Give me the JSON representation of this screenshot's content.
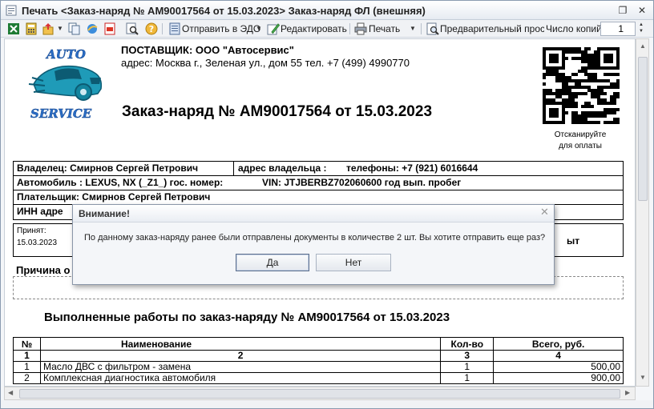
{
  "window": {
    "title": "Печать <Заказ-наряд № АМ90017564 от 15.03.2023> Заказ-наряд ФЛ (внешняя)"
  },
  "toolbar": {
    "send_edo": "Отправить в ЭДО",
    "edit": "Редактировать",
    "print": "Печать",
    "preview": "Предварительный просмотр",
    "copies_label": "Число копий",
    "copies_value": "1"
  },
  "document": {
    "supplier": "ПОСТАВЩИК:  ООО \"Автосервис\"",
    "address": "адрес: Москва г., Зеленая ул., дом 55 тел. +7 (499) 4990770",
    "order_title": "Заказ-наряд № АМ90017564 от 15.03.2023",
    "logo_top": "AUTO",
    "logo_bottom": "SERVICE",
    "qr_caption_1": "Отсканируйте",
    "qr_caption_2": "для оплаты",
    "owner": "Владелец: Смирнов Сергей Петрович",
    "owner_address": "адрес владельца :",
    "phones": "телефоны: +7 (921) 6016644",
    "car": "Автомобиль : LEXUS, NX (_Z1_)   гос. номер:",
    "vin": "VIN: JTJBERBZ702060600 год вып.  пробег",
    "payer": "Плательщик:  Смирнов Сергей Петрович",
    "inn": "ИНН     адре",
    "accepted_label": "Принят:",
    "accepted_date": "15.03.2023",
    "accepted_right": "ыт",
    "reason_label": "Причина о",
    "works_title": "Выполненные работы по заказ-наряду №  АМ90017564 от 15.03.2023"
  },
  "works_table": {
    "headers": [
      "№",
      "Наименование",
      "Кол-во",
      "Всего, руб."
    ],
    "numbers": [
      "1",
      "2",
      "3",
      "4"
    ],
    "rows": [
      {
        "n": "1",
        "name": "Масло ДВС с фильтром - замена",
        "qty": "1",
        "total": "500,00"
      },
      {
        "n": "2",
        "name": "Комплексная диагностика автомобиля",
        "qty": "1",
        "total": "900,00"
      }
    ]
  },
  "dialog": {
    "title": "Внимание!",
    "message": "По данному заказ-наряду ранее были отправлены документы в количестве 2 шт. Вы хотите отправить еще раз?",
    "yes": "Да",
    "no": "Нет"
  }
}
